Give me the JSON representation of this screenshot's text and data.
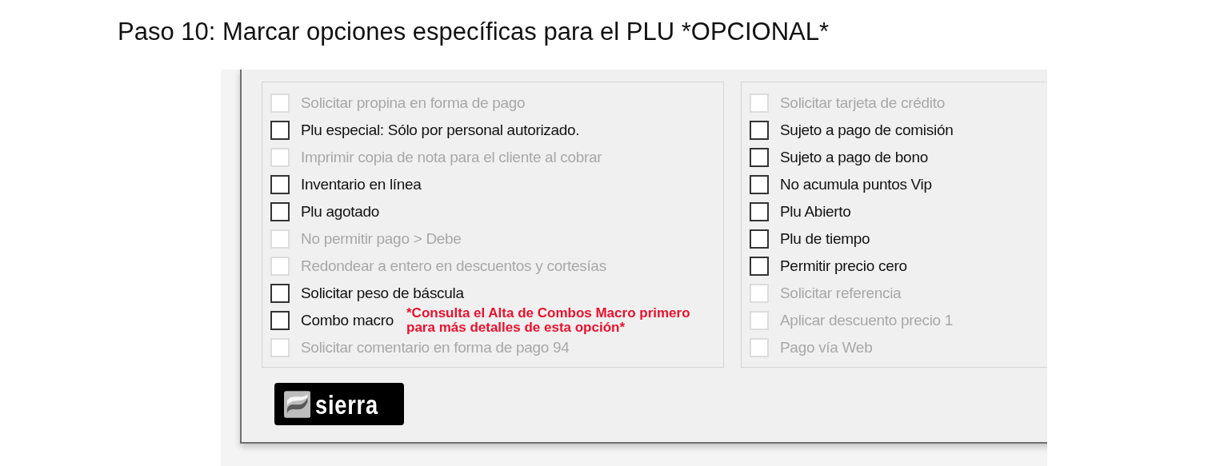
{
  "title": "Paso 10: Marcar opciones específicas para el PLU *OPCIONAL*",
  "groups": [
    {
      "options": [
        {
          "label": "Solicitar propina en forma de pago",
          "checked": false,
          "disabled": true
        },
        {
          "label": "Plu especial:  Sólo por personal autorizado.",
          "checked": false,
          "disabled": false
        },
        {
          "label": "Imprimir copia de nota para el cliente al cobrar",
          "checked": false,
          "disabled": true
        },
        {
          "label": "Inventario en línea",
          "checked": false,
          "disabled": false
        },
        {
          "label": "Plu agotado",
          "checked": false,
          "disabled": false
        },
        {
          "label": "No permitir pago > Debe",
          "checked": false,
          "disabled": true
        },
        {
          "label": "Redondear a entero en descuentos y cortesías",
          "checked": false,
          "disabled": true
        },
        {
          "label": "Solicitar peso de báscula",
          "checked": false,
          "disabled": false
        },
        {
          "label": "Combo macro",
          "checked": false,
          "disabled": false
        },
        {
          "label": "Solicitar comentario en forma de pago 94",
          "checked": false,
          "disabled": true
        }
      ]
    },
    {
      "options": [
        {
          "label": "Solicitar tarjeta de crédito",
          "checked": false,
          "disabled": true
        },
        {
          "label": "Sujeto a pago de comisión",
          "checked": false,
          "disabled": false
        },
        {
          "label": "Sujeto a pago de bono",
          "checked": false,
          "disabled": false
        },
        {
          "label": "No acumula puntos Vip",
          "checked": false,
          "disabled": false
        },
        {
          "label": "Plu Abierto",
          "checked": false,
          "disabled": false
        },
        {
          "label": "Plu de tiempo",
          "checked": false,
          "disabled": false
        },
        {
          "label": "Permitir precio cero",
          "checked": false,
          "disabled": false
        },
        {
          "label": "Solicitar referencia",
          "checked": false,
          "disabled": true
        },
        {
          "label": "Aplicar descuento precio 1",
          "checked": false,
          "disabled": true
        },
        {
          "label": "Pago vía Web",
          "checked": false,
          "disabled": true
        }
      ]
    }
  ],
  "note": {
    "lines": [
      "*Consulta el Alta de Combos Macro primero",
      "para más detalles de esta opción*"
    ]
  },
  "logo": {
    "text": "sierra"
  }
}
